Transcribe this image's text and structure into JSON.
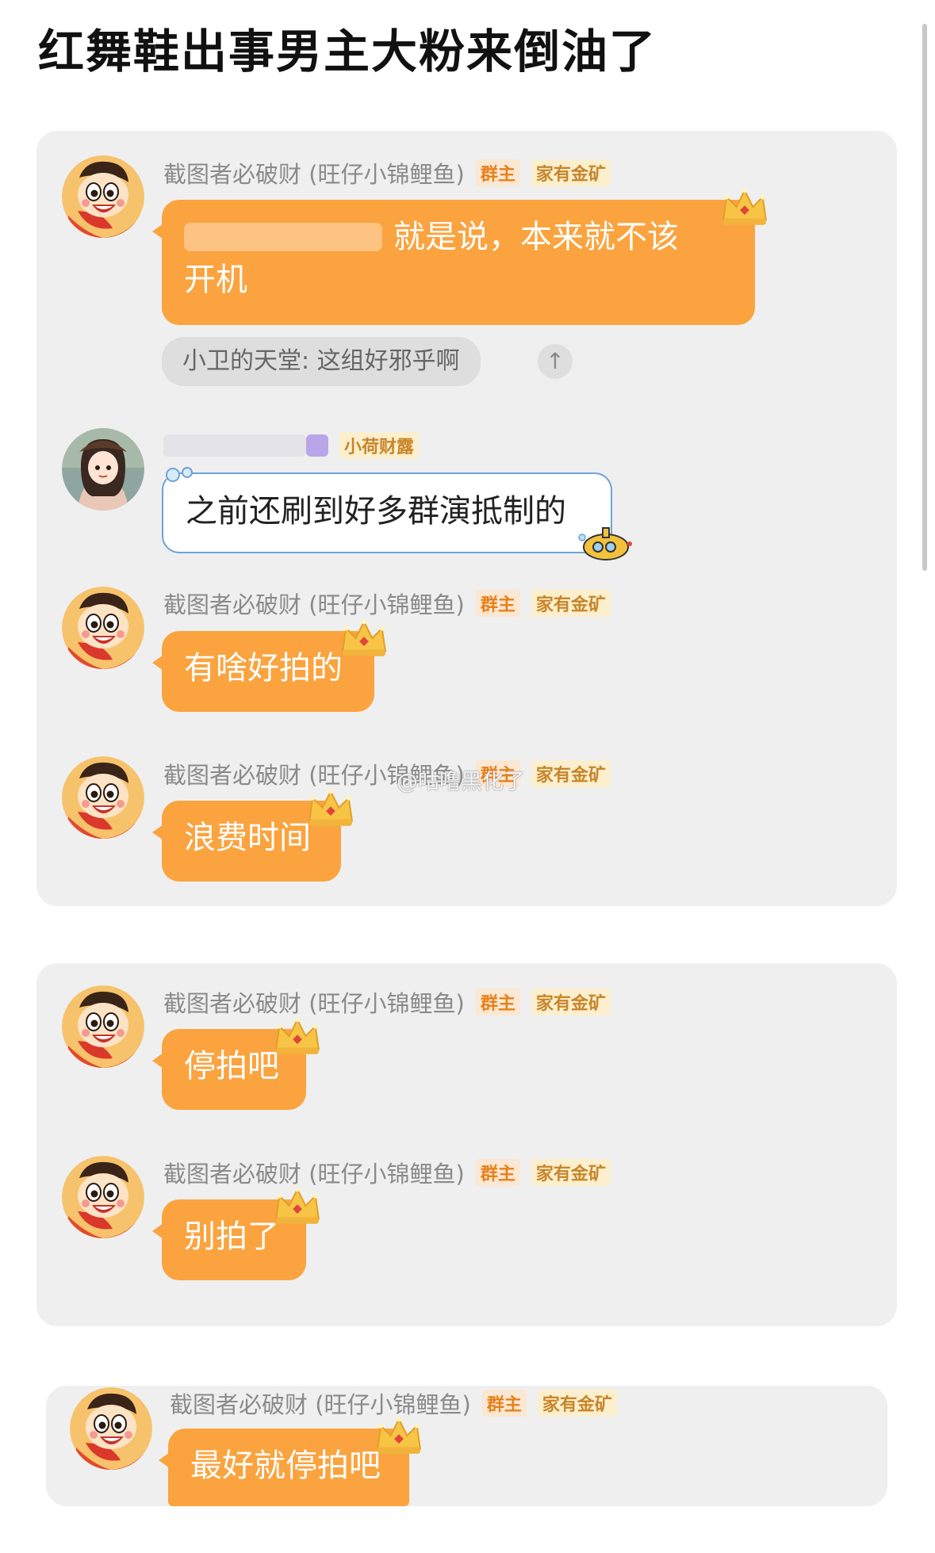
{
  "title": "红舞鞋出事男主大粉来倒油了",
  "owner": {
    "name": "截图者必破财 (旺仔小锦鲤鱼)",
    "tag_owner": "群主",
    "tag_gold": "家有金矿"
  },
  "card1": {
    "msg1": {
      "text_line1_visible": "就是说，本来就不该",
      "text_line2": "开机"
    },
    "quote": {
      "text": "小卫的天堂: 这组好邪乎啊",
      "up_icon": "↑"
    },
    "msg2": {
      "tag": "小荷财露",
      "text": "之前还刷到好多群演抵制的"
    },
    "msg3": {
      "text": "有啥好拍的"
    },
    "msg4": {
      "text": "浪费时间"
    },
    "watermark": "@咕噜黑化了"
  },
  "card2": {
    "msg1": {
      "text": "停拍吧"
    },
    "msg2": {
      "text": "别拍了"
    }
  },
  "card3": {
    "msg1": {
      "text": "最好就停拍吧"
    }
  },
  "colors": {
    "bubble": "#fba33f",
    "card": "#efefef",
    "tag_owner": "#e8801a",
    "tag_gold": "#c9852a"
  }
}
